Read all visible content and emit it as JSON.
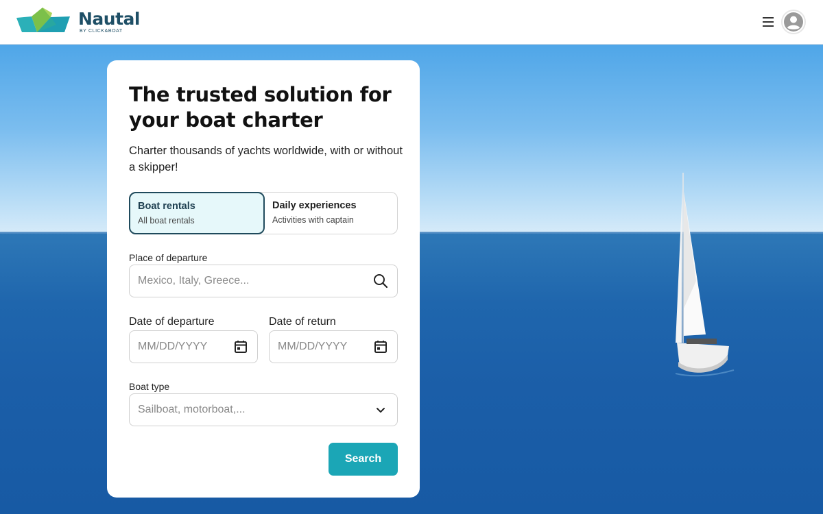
{
  "header": {
    "logo_name": "Nautal",
    "logo_sub": "BY CLICK&BOAT",
    "menu_icon": "hamburger-menu-icon",
    "avatar_icon": "user-avatar-icon"
  },
  "hero": {
    "title": "The trusted solution for your boat charter",
    "subtitle": "Charter thousands of yachts worldwide, with or without a skipper!"
  },
  "tabs": [
    {
      "label": "Boat rentals",
      "description": "All boat rentals",
      "active": true
    },
    {
      "label": "Daily experiences",
      "description": "Activities with captain",
      "active": false
    }
  ],
  "form": {
    "departure_place": {
      "label": "Place of departure",
      "placeholder": "Mexico, Italy, Greece...",
      "icon": "search-icon"
    },
    "departure_date": {
      "label": "Date of departure",
      "placeholder": "MM/DD/YYYY",
      "icon": "calendar-icon"
    },
    "return_date": {
      "label": "Date of return",
      "placeholder": "MM/DD/YYYY",
      "icon": "calendar-icon"
    },
    "boat_type": {
      "label": "Boat type",
      "placeholder": "Sailboat, motorboat,...",
      "icon": "chevron-down-icon"
    },
    "search_label": "Search"
  },
  "colors": {
    "brand_dark": "#1e4f66",
    "accent": "#1ba6b6",
    "tab_active_bg": "#e6f8fa"
  }
}
